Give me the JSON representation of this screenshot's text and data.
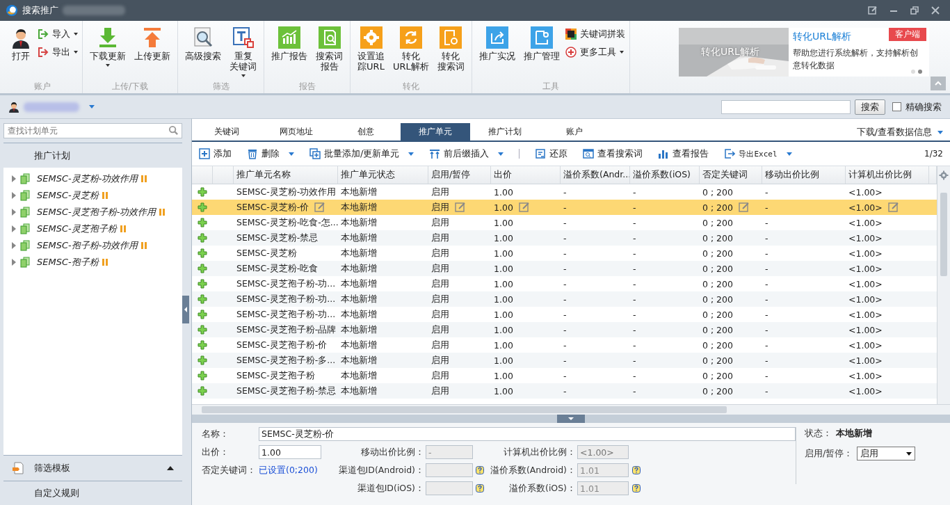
{
  "window": {
    "title": "搜索推广"
  },
  "ribbon": {
    "groups": [
      {
        "label": "账户",
        "items": [
          {
            "kind": "large",
            "label": [
              "打开"
            ],
            "dropdown": false
          },
          {
            "kind": "small",
            "label": "导入",
            "dropdown": true
          },
          {
            "kind": "small",
            "label": "导出",
            "dropdown": true
          }
        ]
      },
      {
        "label": "上传/下载",
        "items": [
          {
            "kind": "large",
            "label": [
              "下载更新"
            ],
            "dropdown": true
          },
          {
            "kind": "large",
            "label": [
              "上传更新"
            ],
            "dropdown": false
          }
        ]
      },
      {
        "label": "筛选",
        "items": [
          {
            "kind": "large",
            "label": [
              "高级搜索"
            ],
            "dropdown": false
          },
          {
            "kind": "large",
            "label": [
              "重复",
              "关键词"
            ],
            "dropdown": true
          }
        ]
      },
      {
        "label": "报告",
        "items": [
          {
            "kind": "large",
            "label": [
              "推广报告"
            ],
            "dropdown": false
          },
          {
            "kind": "large",
            "label": [
              "搜索词",
              "报告"
            ],
            "dropdown": false
          }
        ]
      },
      {
        "label": "转化",
        "items": [
          {
            "kind": "large",
            "label": [
              "设置追",
              "踪URL"
            ],
            "dropdown": false
          },
          {
            "kind": "large",
            "label": [
              "转化",
              "URL解析"
            ],
            "dropdown": false
          },
          {
            "kind": "large",
            "label": [
              "转化",
              "搜索词"
            ],
            "dropdown": false
          }
        ]
      },
      {
        "label": "工具",
        "items": [
          {
            "kind": "large",
            "label": [
              "推广实况"
            ],
            "dropdown": false
          },
          {
            "kind": "large",
            "label": [
              "推广管理"
            ],
            "dropdown": false
          },
          {
            "kind": "small",
            "label": "关键词拼装",
            "dropdown": false
          },
          {
            "kind": "small",
            "label": "更多工具",
            "dropdown": true
          }
        ]
      }
    ]
  },
  "banner": {
    "caption": "转化URL解析",
    "title": "转化URL解析",
    "badge": "客户端",
    "description": "帮助您进行系统解析，支持解析创意转化数据",
    "dots": [
      {
        "selected": false
      },
      {
        "selected": true
      }
    ]
  },
  "account_bar": {
    "search_button": "搜索",
    "exact_search": {
      "label": "精确搜索",
      "checked": false
    }
  },
  "sidebar": {
    "search": {
      "placeholder": "查找计划单元"
    },
    "header": "推广计划",
    "items": [
      {
        "label": "SEMSC-灵芝粉-功效作用",
        "expanded": false,
        "paused": true
      },
      {
        "label": "SEMSC-灵芝粉",
        "expanded": false,
        "paused": true
      },
      {
        "label": "SEMSC-灵芝孢子粉-功效作用",
        "expanded": false,
        "paused": true
      },
      {
        "label": "SEMSC-灵芝孢子粉",
        "expanded": false,
        "paused": true
      },
      {
        "label": "SEMSC-孢子粉-功效作用",
        "expanded": false,
        "paused": true
      },
      {
        "label": "SEMSC-孢子粉",
        "expanded": false,
        "paused": true
      }
    ],
    "filter_template": {
      "label": "筛选模板",
      "expanded": true
    },
    "custom_rules": "自定义规则"
  },
  "tabs": [
    {
      "label": "关键词",
      "selected": false
    },
    {
      "label": "网页地址",
      "selected": false
    },
    {
      "label": "创意",
      "selected": false
    },
    {
      "label": "推广单元",
      "selected": true
    },
    {
      "label": "推广计划",
      "selected": false
    },
    {
      "label": "账户",
      "selected": false
    }
  ],
  "data_menu": "下载/查看数据信息",
  "toolbar": {
    "items": [
      {
        "label": "添加",
        "dropdown": false,
        "separator_before": false
      },
      {
        "label": "删除",
        "dropdown": true,
        "separator_before": false
      },
      {
        "label": "批量添加/更新单元",
        "dropdown": true,
        "separator_before": false
      },
      {
        "label": "前后缀插入",
        "dropdown": true,
        "separator_before": false
      },
      {
        "label": "还原",
        "dropdown": false,
        "separator_before": true
      },
      {
        "label": "查看搜索词",
        "dropdown": false,
        "separator_before": false
      },
      {
        "label": "查看报告",
        "dropdown": false,
        "separator_before": false
      },
      {
        "label": "导出Excel",
        "dropdown": true,
        "separator_before": false
      }
    ],
    "page": "1/32"
  },
  "table": {
    "columns": [
      "推广单元名称",
      "推广单元状态",
      "启用/暂停",
      "出价",
      "溢价系数(Andr...",
      "溢价系数(iOS)",
      "否定关键词",
      "移动出价比例",
      "计算机出价比例"
    ],
    "rows": [
      {
        "name": "SEMSC-灵芝粉-功效作用",
        "status": "本地新增",
        "enabled": "启用",
        "price": "1.00",
        "premium_android": "-",
        "premium_ios": "-",
        "negative_keywords": "0 ; 200",
        "mobile_ratio": "-",
        "pc_ratio": "<1.00>",
        "selected": false
      },
      {
        "name": "SEMSC-灵芝粉-价",
        "status": "本地新增",
        "enabled": "启用",
        "price": "1.00",
        "premium_android": "-",
        "premium_ios": "-",
        "negative_keywords": "0 ; 200",
        "mobile_ratio": "-",
        "pc_ratio": "<1.00>",
        "selected": true
      },
      {
        "name": "SEMSC-灵芝粉-吃食-怎...",
        "status": "本地新增",
        "enabled": "启用",
        "price": "1.00",
        "premium_android": "-",
        "premium_ios": "-",
        "negative_keywords": "0 ; 200",
        "mobile_ratio": "-",
        "pc_ratio": "<1.00>",
        "selected": false
      },
      {
        "name": "SEMSC-灵芝粉-禁忌",
        "status": "本地新增",
        "enabled": "启用",
        "price": "1.00",
        "premium_android": "-",
        "premium_ios": "-",
        "negative_keywords": "0 ; 200",
        "mobile_ratio": "-",
        "pc_ratio": "<1.00>",
        "selected": false
      },
      {
        "name": "SEMSC-灵芝粉",
        "status": "本地新增",
        "enabled": "启用",
        "price": "1.00",
        "premium_android": "-",
        "premium_ios": "-",
        "negative_keywords": "0 ; 200",
        "mobile_ratio": "-",
        "pc_ratio": "<1.00>",
        "selected": false
      },
      {
        "name": "SEMSC-灵芝粉-吃食",
        "status": "本地新增",
        "enabled": "启用",
        "price": "1.00",
        "premium_android": "-",
        "premium_ios": "-",
        "negative_keywords": "0 ; 200",
        "mobile_ratio": "-",
        "pc_ratio": "<1.00>",
        "selected": false
      },
      {
        "name": "SEMSC-灵芝孢子粉-功...",
        "status": "本地新增",
        "enabled": "启用",
        "price": "1.00",
        "premium_android": "-",
        "premium_ios": "-",
        "negative_keywords": "0 ; 200",
        "mobile_ratio": "-",
        "pc_ratio": "<1.00>",
        "selected": false
      },
      {
        "name": "SEMSC-灵芝孢子粉-功...",
        "status": "本地新增",
        "enabled": "启用",
        "price": "1.00",
        "premium_android": "-",
        "premium_ios": "-",
        "negative_keywords": "0 ; 200",
        "mobile_ratio": "-",
        "pc_ratio": "<1.00>",
        "selected": false
      },
      {
        "name": "SEMSC-灵芝孢子粉-功...",
        "status": "本地新增",
        "enabled": "启用",
        "price": "1.00",
        "premium_android": "-",
        "premium_ios": "-",
        "negative_keywords": "0 ; 200",
        "mobile_ratio": "-",
        "pc_ratio": "<1.00>",
        "selected": false
      },
      {
        "name": "SEMSC-灵芝孢子粉-品牌",
        "status": "本地新增",
        "enabled": "启用",
        "price": "1.00",
        "premium_android": "-",
        "premium_ios": "-",
        "negative_keywords": "0 ; 200",
        "mobile_ratio": "-",
        "pc_ratio": "<1.00>",
        "selected": false
      },
      {
        "name": "SEMSC-灵芝孢子粉-价",
        "status": "本地新增",
        "enabled": "启用",
        "price": "1.00",
        "premium_android": "-",
        "premium_ios": "-",
        "negative_keywords": "0 ; 200",
        "mobile_ratio": "-",
        "pc_ratio": "<1.00>",
        "selected": false
      },
      {
        "name": "SEMSC-灵芝孢子粉-多...",
        "status": "本地新增",
        "enabled": "启用",
        "price": "1.00",
        "premium_android": "-",
        "premium_ios": "-",
        "negative_keywords": "0 ; 200",
        "mobile_ratio": "-",
        "pc_ratio": "<1.00>",
        "selected": false
      },
      {
        "name": "SEMSC-灵芝孢子粉",
        "status": "本地新增",
        "enabled": "启用",
        "price": "1.00",
        "premium_android": "-",
        "premium_ios": "-",
        "negative_keywords": "0 ; 200",
        "mobile_ratio": "-",
        "pc_ratio": "<1.00>",
        "selected": false
      },
      {
        "name": "SEMSC-灵芝孢子粉-禁忌",
        "status": "本地新增",
        "enabled": "启用",
        "price": "1.00",
        "premium_android": "-",
        "premium_ios": "-",
        "negative_keywords": "0 ; 200",
        "mobile_ratio": "-",
        "pc_ratio": "<1.00>",
        "selected": false
      }
    ]
  },
  "form": {
    "name": {
      "label": "名称：",
      "value": "SEMSC-灵芝粉-价"
    },
    "price": {
      "label": "出价：",
      "value": "1.00"
    },
    "mobile_ratio": {
      "label": "移动出价比例：",
      "value": "-",
      "disabled": true
    },
    "pc_ratio": {
      "label": "计算机出价比例：",
      "placeholder": "<1.00>",
      "disabled": true
    },
    "negative_keywords": {
      "label": "否定关键词：",
      "link": "已设置(0;200)"
    },
    "channel_android": {
      "label": "渠道包ID(Android)：",
      "disabled": true
    },
    "premium_android": {
      "label": "溢价系数(Android)：",
      "value": "1.01",
      "disabled": true
    },
    "channel_ios": {
      "label": "渠道包ID(iOS)：",
      "disabled": true
    },
    "premium_ios": {
      "label": "溢价系数(iOS)：",
      "value": "1.01",
      "disabled": true
    },
    "status": {
      "label": "状态：",
      "value": "本地新增"
    },
    "enabled": {
      "label": "启用/暂停：",
      "value": "启用"
    }
  }
}
